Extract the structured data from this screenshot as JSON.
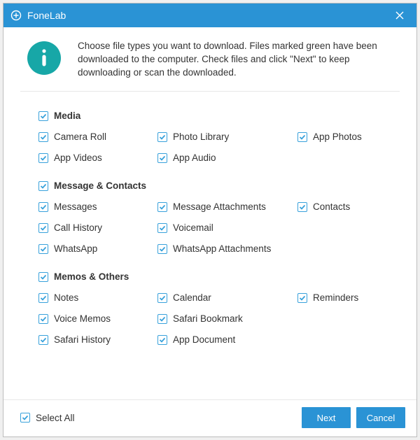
{
  "title": "FoneLab",
  "intro": "Choose file types you want to download. Files marked green have been downloaded to the computer. Check files and click \"Next\" to keep downloading or scan the downloaded.",
  "groups": [
    {
      "name": "Media",
      "checked": true,
      "items": [
        {
          "label": "Camera Roll",
          "checked": true
        },
        {
          "label": "Photo Library",
          "checked": true
        },
        {
          "label": "App Photos",
          "checked": true
        },
        {
          "label": "App Videos",
          "checked": true
        },
        {
          "label": "App Audio",
          "checked": true
        }
      ]
    },
    {
      "name": "Message & Contacts",
      "checked": true,
      "items": [
        {
          "label": "Messages",
          "checked": true
        },
        {
          "label": "Message Attachments",
          "checked": true
        },
        {
          "label": "Contacts",
          "checked": true
        },
        {
          "label": "Call History",
          "checked": true
        },
        {
          "label": "Voicemail",
          "checked": true
        },
        {
          "label": "",
          "checked": null
        },
        {
          "label": "WhatsApp",
          "checked": true
        },
        {
          "label": "WhatsApp Attachments",
          "checked": true
        }
      ]
    },
    {
      "name": "Memos & Others",
      "checked": true,
      "items": [
        {
          "label": "Notes",
          "checked": true
        },
        {
          "label": "Calendar",
          "checked": true
        },
        {
          "label": "Reminders",
          "checked": true
        },
        {
          "label": "Voice Memos",
          "checked": true
        },
        {
          "label": "Safari Bookmark",
          "checked": true
        },
        {
          "label": "",
          "checked": null
        },
        {
          "label": "Safari History",
          "checked": true
        },
        {
          "label": "App Document",
          "checked": true
        }
      ]
    }
  ],
  "selectAll": {
    "label": "Select All",
    "checked": true
  },
  "buttons": {
    "next": "Next",
    "cancel": "Cancel"
  },
  "colors": {
    "titlebar": "#2a93d5",
    "checkbox": "#38a1db",
    "info": "#17a7a7"
  }
}
